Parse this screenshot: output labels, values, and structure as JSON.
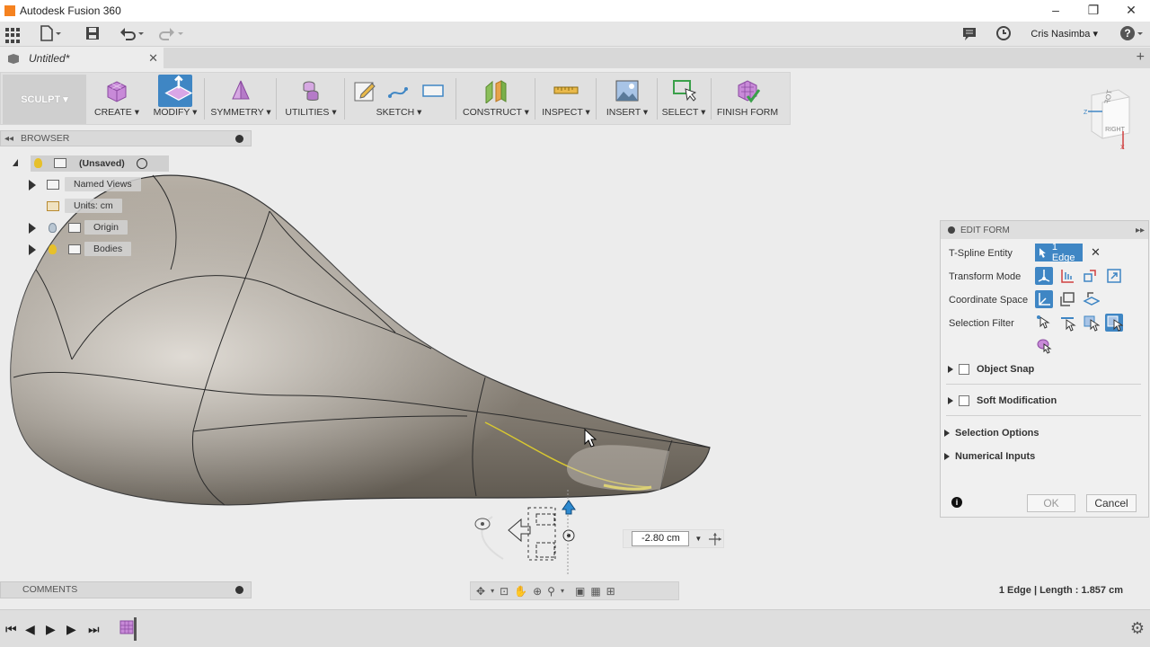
{
  "app": {
    "title": "Autodesk Fusion 360",
    "document_tab": "Untitled*",
    "user": "Cris Nasimba ▾"
  },
  "window_controls": [
    "–",
    "❐",
    "✕"
  ],
  "workspace": {
    "label": "SCULPT ▾"
  },
  "ribbon": {
    "groups": [
      {
        "label": "CREATE ▾",
        "icon": "box-icon"
      },
      {
        "label": "MODIFY ▾",
        "icon": "modify-icon"
      },
      {
        "label": "SYMMETRY ▾",
        "icon": "symmetry-icon"
      },
      {
        "label": "UTILITIES ▾",
        "icon": "utilities-icon"
      },
      {
        "label": "SKETCH ▾",
        "icon": "sketch-icon"
      },
      {
        "label": "CONSTRUCT ▾",
        "icon": "plane-icon"
      },
      {
        "label": "INSPECT ▾",
        "icon": "measure-icon"
      },
      {
        "label": "INSERT ▾",
        "icon": "image-icon"
      },
      {
        "label": "SELECT ▾",
        "icon": "select-icon"
      },
      {
        "label": "FINISH FORM",
        "icon": "finish-form-icon"
      }
    ]
  },
  "browser": {
    "header": "BROWSER",
    "root": "(Unsaved)",
    "items": [
      "Named Views",
      "Units: cm",
      "Origin",
      "Bodies"
    ]
  },
  "viewcube": {
    "face_label": "RIGHT",
    "axis_x": "X",
    "axis_z": "Z"
  },
  "edit_form": {
    "header": "EDIT FORM",
    "t_spline_label": "T-Spline Entity",
    "entity_value": "1 Edge",
    "transform_mode_label": "Transform Mode",
    "coordinate_space_label": "Coordinate Space",
    "selection_filter_label": "Selection Filter",
    "object_snap": "Object Snap",
    "soft_modification": "Soft Modification",
    "selection_options": "Selection Options",
    "numerical_inputs": "Numerical Inputs",
    "ok": "OK",
    "cancel": "Cancel"
  },
  "dimension_input": {
    "value": "-2.80 cm"
  },
  "comments": {
    "label": "COMMENTS"
  },
  "status": {
    "text": "1 Edge | Length : 1.857 cm"
  },
  "colors": {
    "accent": "#3f86c4",
    "body": "#8f887e",
    "ribbon": "#e0e0e0"
  }
}
